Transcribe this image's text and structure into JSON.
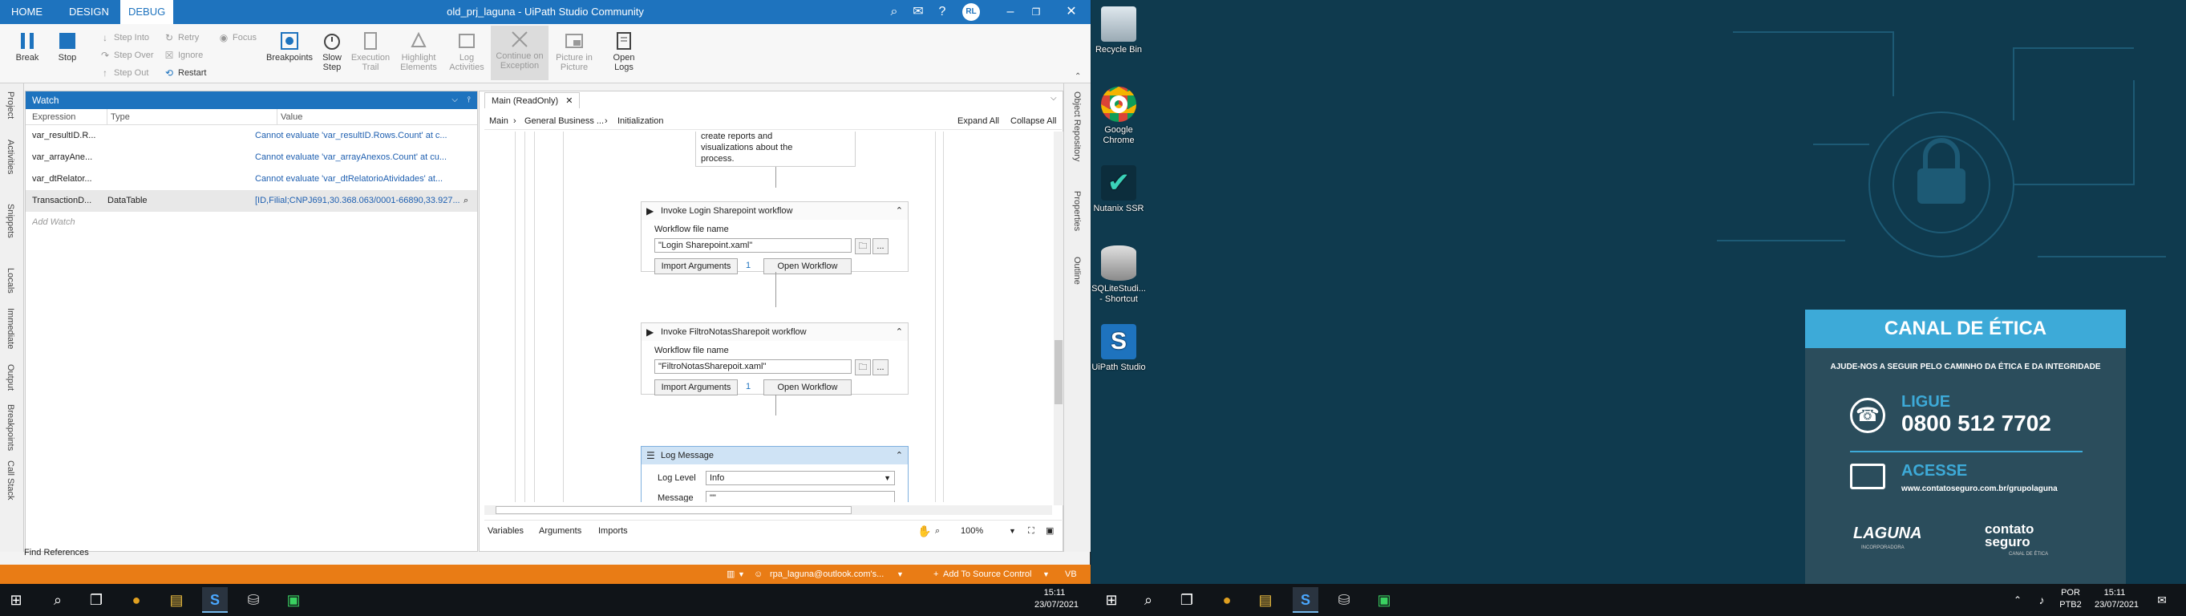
{
  "window": {
    "title": "old_prj_laguna - UiPath Studio Community",
    "tabs": [
      "HOME",
      "DESIGN",
      "DEBUG"
    ],
    "active_tab": "DEBUG",
    "user_initials": "RL"
  },
  "ribbon": {
    "large": [
      {
        "label": "Break"
      },
      {
        "label": "Stop"
      },
      {
        "label": "Breakpoints"
      },
      {
        "label": "Slow Step"
      },
      {
        "label": "Execution Trail"
      },
      {
        "label": "Highlight Elements"
      },
      {
        "label": "Log Activities"
      },
      {
        "label": "Continue on Exception"
      },
      {
        "label": "Picture in Picture"
      },
      {
        "label": "Open Logs"
      }
    ],
    "small": [
      "Step Into",
      "Step Over",
      "Step Out",
      "Retry",
      "Ignore",
      "Restart",
      "Focus"
    ]
  },
  "left_rail": [
    "Project",
    "Activities",
    "Snippets",
    "Locals",
    "Immediate",
    "Output",
    "Breakpoints",
    "Call Stack"
  ],
  "right_rail": [
    "Object Repository",
    "Properties",
    "Outline"
  ],
  "watch": {
    "title": "Watch",
    "columns": [
      "Expression",
      "Type",
      "Value"
    ],
    "rows": [
      {
        "expr": "var_resultID.R...",
        "type": "",
        "value": "Cannot evaluate 'var_resultID.Rows.Count' at c..."
      },
      {
        "expr": "var_arrayAne...",
        "type": "",
        "value": "Cannot evaluate 'var_arrayAnexos.Count' at cu..."
      },
      {
        "expr": "var_dtRelator...",
        "type": "",
        "value": "Cannot evaluate 'var_dtRelatorioAtividades' at..."
      },
      {
        "expr": "TransactionD...",
        "type": "DataTable",
        "value": "[ID,Filial;CNPJ691,30.368.063/0001-66890,33.927..."
      }
    ],
    "add": "Add Watch"
  },
  "designer": {
    "doc_tab": "Main (ReadOnly)",
    "breadcrumb": [
      "Main",
      "General Business ...",
      "Initialization"
    ],
    "expand_all": "Expand All",
    "collapse_all": "Collapse All",
    "annotation": [
      "create reports and",
      "visualizations about the",
      "process."
    ],
    "acts": [
      {
        "title": "Invoke Login Sharepoint workflow",
        "field_label": "Workflow file name",
        "file": "\"Login Sharepoint.xaml\"",
        "import": "Import Arguments",
        "count": "1",
        "open": "Open Workflow"
      },
      {
        "title": "Invoke FiltroNotasSharepoit workflow",
        "field_label": "Workflow file name",
        "file": "\"FiltroNotasSharepoit.xaml\"",
        "import": "Import Arguments",
        "count": "1",
        "open": "Open Workflow"
      }
    ],
    "log": {
      "title": "Log Message",
      "level_label": "Log Level",
      "level": "Info",
      "message_label": "Message",
      "message": "\"\""
    },
    "footer": {
      "variables": "Variables",
      "arguments": "Arguments",
      "imports": "Imports",
      "zoom": "100%"
    }
  },
  "find_references": "Find References",
  "status": {
    "account": "rpa_laguna@outlook.com's...",
    "source": "Add To Source Control",
    "lang": "VB"
  },
  "taskbar": {
    "left_time": "15:11",
    "left_date": "23/07/2021",
    "lang": "POR",
    "layout": "PTB2",
    "right_time": "15:11",
    "right_date": "23/07/2021"
  },
  "desktop_icons": [
    {
      "label": "Recycle Bin"
    },
    {
      "label": "Google Chrome"
    },
    {
      "label": "Nutanix SSR"
    },
    {
      "label": "SQLiteStudi... - Shortcut"
    },
    {
      "label": "UiPath Studio"
    }
  ],
  "ethics": {
    "heading": "CANAL DE ÉTICA",
    "tagline": "AJUDE-NOS A SEGUIR PELO CAMINHO DA ÉTICA E DA INTEGRIDADE",
    "call_label": "LIGUE",
    "phone": "0800 512 7702",
    "access_label": "ACESSE",
    "url": "www.contatoseguro.com.br/grupolaguna",
    "logo1": "LAGUNA",
    "logo1_sub": "INCORPORADORA",
    "logo2": "contato seguro",
    "logo2_sub": "CANAL DE ÉTICA"
  }
}
